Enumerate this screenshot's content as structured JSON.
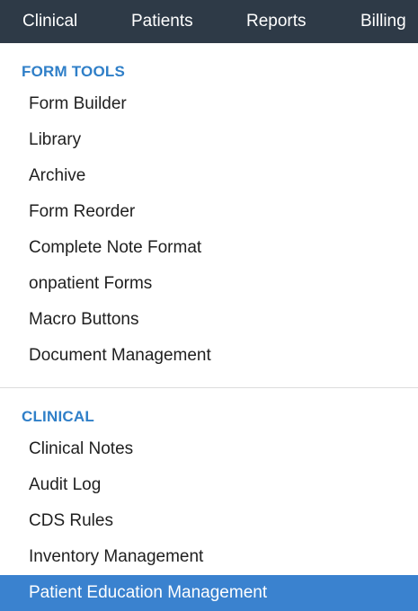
{
  "topnav": {
    "items": [
      "Clinical",
      "Patients",
      "Reports",
      "Billing"
    ]
  },
  "sections": [
    {
      "header": "FORM TOOLS",
      "items": [
        "Form Builder",
        "Library",
        "Archive",
        "Form Reorder",
        "Complete Note Format",
        "onpatient Forms",
        "Macro Buttons",
        "Document Management"
      ]
    },
    {
      "header": "CLINICAL",
      "items": [
        "Clinical Notes",
        "Audit Log",
        "CDS Rules",
        "Inventory Management",
        "Patient Education Management"
      ]
    }
  ],
  "active_item": "Patient Education Management",
  "colors": {
    "nav_bg": "#2e3a47",
    "section_header": "#2f7fc8",
    "active_bg": "#3a82cf"
  }
}
